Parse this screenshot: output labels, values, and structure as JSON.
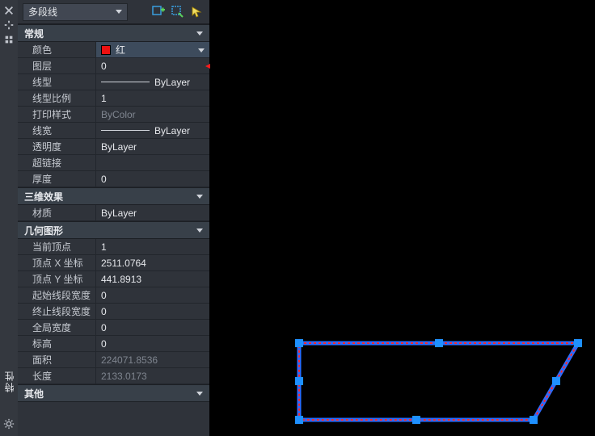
{
  "rail": {
    "title": "特性"
  },
  "selector": {
    "type_label": "多段线"
  },
  "sections": {
    "general": {
      "title": "常规",
      "color_label": "颜色",
      "color_value": "红",
      "layer_label": "图层",
      "layer_value": "0",
      "linetype_label": "线型",
      "linetype_value": "ByLayer",
      "ltscale_label": "线型比例",
      "ltscale_value": "1",
      "plotstyle_label": "打印样式",
      "plotstyle_value": "ByColor",
      "lineweight_label": "线宽",
      "lineweight_value": "ByLayer",
      "transparency_label": "透明度",
      "transparency_value": "ByLayer",
      "hyperlink_label": "超链接",
      "hyperlink_value": "",
      "thickness_label": "厚度",
      "thickness_value": "0"
    },
    "threeD": {
      "title": "三维效果",
      "material_label": "材质",
      "material_value": "ByLayer"
    },
    "geometry": {
      "title": "几何图形",
      "curvertex_label": "当前顶点",
      "curvertex_value": "1",
      "vx_label": "顶点 X 坐标",
      "vx_value": "2511.0764",
      "vy_label": "顶点 Y 坐标",
      "vy_value": "441.8913",
      "startw_label": "起始线段宽度",
      "startw_value": "0",
      "endw_label": "终止线段宽度",
      "endw_value": "0",
      "globalw_label": "全局宽度",
      "globalw_value": "0",
      "elev_label": "标高",
      "elev_value": "0",
      "area_label": "面积",
      "area_value": "224071.8536",
      "length_label": "长度",
      "length_value": "2133.0173"
    },
    "other": {
      "title": "其他"
    }
  },
  "colors": {
    "accent_red": "#e11",
    "grip_blue": "#1e90ff",
    "outline": "#c02050"
  }
}
